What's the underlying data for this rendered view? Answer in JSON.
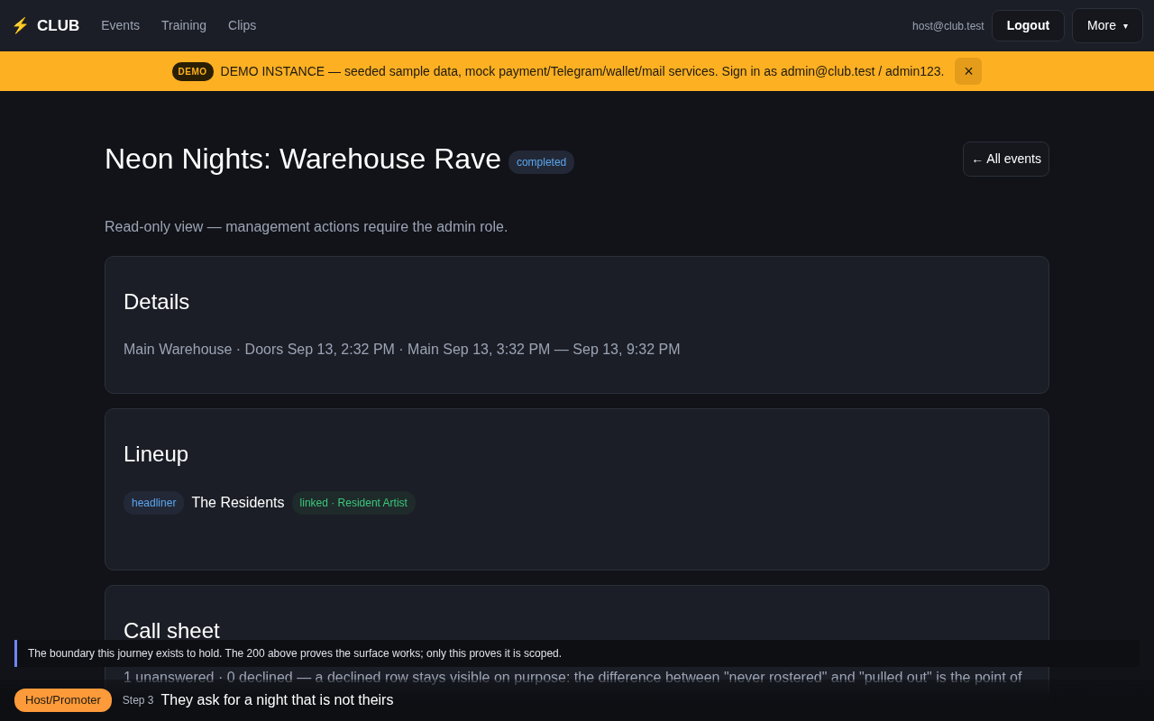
{
  "navbar": {
    "brand_icon": "⚡",
    "brand": "CLUB",
    "links": [
      "Events",
      "Training",
      "Clips"
    ],
    "user": "host@club.test",
    "logout": "Logout",
    "more": "More",
    "more_caret": "▾"
  },
  "banner": {
    "badge": "DEMO",
    "text": "DEMO INSTANCE — seeded sample data, mock payment/Telegram/wallet/mail services. Sign in as admin@club.test / admin123.",
    "close": "×"
  },
  "event": {
    "title": "Neon Nights: Warehouse Rave",
    "status": "completed",
    "back": "← All events",
    "note": "Read-only view — management actions require the admin role."
  },
  "details": {
    "title": "Details",
    "text": "Main Warehouse · Doors Sep 13, 2:32 PM · Main Sep 13, 3:32 PM — Sep 13, 9:32 PM"
  },
  "lineup": {
    "title": "Lineup",
    "entries": [
      {
        "role": "headliner",
        "name": "The Residents",
        "link": "linked · Resident Artist"
      }
    ]
  },
  "call_sheet": {
    "title": "Call sheet",
    "text": "1 unanswered · 0 declined — a declined row stays visible on purpose: the difference between \"never rostered\" and \"pulled out\" is the point of"
  },
  "caption": "The boundary this journey exists to hold. The 200 above proves the surface works; only this proves it is scoped.",
  "footer": {
    "persona": "Host/Promoter",
    "step": "Step 3",
    "headline": "They ask for a night that is not theirs"
  }
}
